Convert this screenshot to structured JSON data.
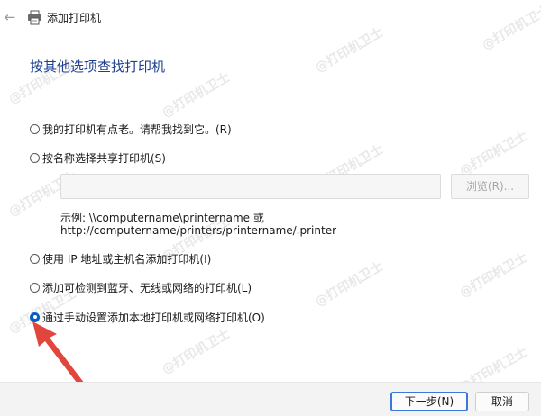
{
  "window": {
    "title": "添加打印机"
  },
  "heading": "按其他选项查找打印机",
  "options": [
    {
      "label": "我的打印机有点老。请帮我找到它。(R)",
      "checked": false
    },
    {
      "label": "按名称选择共享打印机(S)",
      "checked": false
    },
    {
      "label": "使用 IP 地址或主机名添加打印机(I)",
      "checked": false
    },
    {
      "label": "添加可检测到蓝牙、无线或网络的打印机(L)",
      "checked": false
    },
    {
      "label": "通过手动设置添加本地打印机或网络打印机(O)",
      "checked": true
    }
  ],
  "share": {
    "input_value": "",
    "browse_label": "浏览(R)...",
    "example_line1": "示例: \\\\computername\\printername 或",
    "example_line2": "http://computername/printers/printername/.printer"
  },
  "footer": {
    "next_label": "下一步(N)",
    "cancel_label": "取消"
  },
  "watermark": "@打印机卫士",
  "colors": {
    "heading": "#1e3f8f",
    "radio_checked": "#0a5bc4",
    "arrow": "#e2453c"
  },
  "icons": {
    "back": "back-arrow-icon",
    "printer": "printer-icon"
  }
}
